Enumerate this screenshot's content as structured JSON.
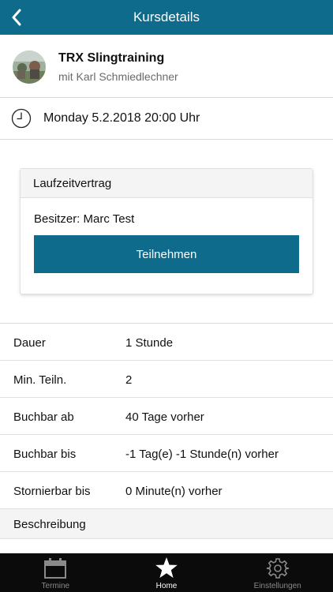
{
  "header": {
    "title": "Kursdetails"
  },
  "course": {
    "name": "TRX Slingtraining",
    "trainer": "mit Karl Schmiedlechner"
  },
  "schedule": {
    "date": "Monday 5.2.2018 20:00 Uhr"
  },
  "contract": {
    "title": "Laufzeitvertrag",
    "owner": "Besitzer: Marc Test",
    "button": "Teilnehmen"
  },
  "details": [
    {
      "label": "Dauer",
      "value": "1 Stunde"
    },
    {
      "label": "Min. Teiln.",
      "value": "2"
    },
    {
      "label": "Buchbar ab",
      "value": "40 Tage vorher"
    },
    {
      "label": "Buchbar bis",
      "value": "-1 Tag(e) -1 Stunde(n) vorher"
    },
    {
      "label": "Stornierbar bis",
      "value": "0 Minute(n) vorher"
    }
  ],
  "description": {
    "title": "Beschreibung"
  },
  "tabbar": [
    {
      "label": "Termine",
      "icon": "calendar-icon"
    },
    {
      "label": "Home",
      "icon": "star-icon",
      "active": true
    },
    {
      "label": "Einstellungen",
      "icon": "gear-icon"
    }
  ],
  "colors": {
    "primary": "#0f6b8c",
    "tabbar": "#0b0b0b"
  }
}
